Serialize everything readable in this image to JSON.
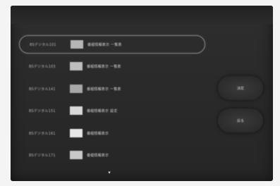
{
  "programs": [
    {
      "channel": "BSデジタル101",
      "title": "番組情報表示 一覧表",
      "thumb_color": "#b5b5b5",
      "selected": true
    },
    {
      "channel": "BSデジタル103",
      "title": "番組情報表示 一覧表",
      "thumb_color": "#bdbdbd",
      "selected": false
    },
    {
      "channel": "BSデジタル141",
      "title": "番組情報表示 一覧表",
      "thumb_color": "#a8a8a8",
      "selected": false
    },
    {
      "channel": "BSデジタル151",
      "title": "番組情報表示 設定",
      "thumb_color": "#d8d8d8",
      "selected": false
    },
    {
      "channel": "BSデジタル161",
      "title": "番組情報表示",
      "thumb_color": "#e6e6e6",
      "selected": false
    },
    {
      "channel": "BSデジタル171",
      "title": "番組情報表示",
      "thumb_color": "#c8c8c8",
      "selected": false
    }
  ],
  "buttons": {
    "first": "決定",
    "second": "戻る"
  },
  "scroll_indicator_icon": "chevron-down-icon"
}
